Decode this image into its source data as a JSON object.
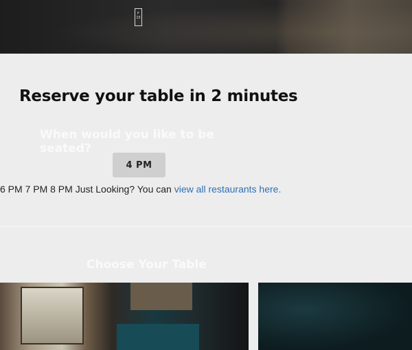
{
  "hero": {
    "date_chip_lines": [
      "F",
      "15"
    ]
  },
  "reservation": {
    "title": "Reserve your table in 2 minutes",
    "question": "When would you like to be seated?",
    "selected_time": "4 PM",
    "other_times": "6 PM 7 PM 8 PM",
    "browse_prefix": "Just Looking? You can",
    "browse_link": "view all restaurants here."
  },
  "tables": {
    "title": "Choose Your Table"
  }
}
